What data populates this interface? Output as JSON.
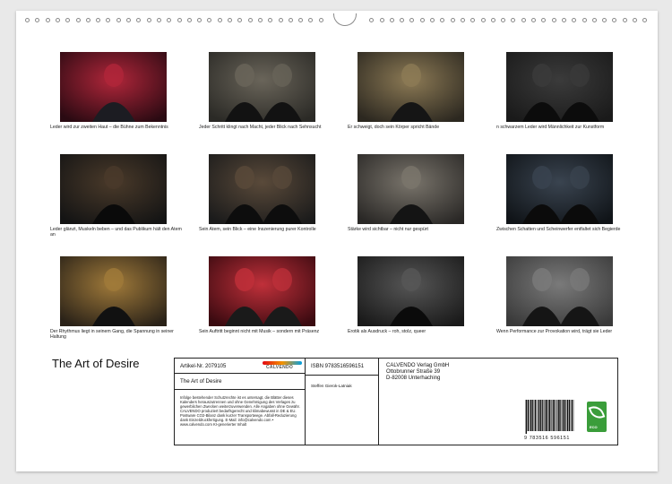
{
  "document": {
    "title": "The Art of Desire"
  },
  "thumbnails": [
    {
      "caption": "Leder wird zur zweiten Haut – die Bühne zum Bekenntnis",
      "icon": "photo-leather-red-light"
    },
    {
      "caption": "Jeder Schritt klingt nach Macht, jeder Blick nach Sehnsucht",
      "icon": "photo-two-men-sunglasses"
    },
    {
      "caption": "Er schweigt, doch sein Körper spricht Bände",
      "icon": "photo-foreheads-touching"
    },
    {
      "caption": "n schwarzem Leder wird Männlichkeit zur Kunstform",
      "icon": "photo-leather-torso"
    },
    {
      "caption": "Leder glänzt, Muskeln beben – und das Publikum hält den Atem an",
      "icon": "photo-blond-gloves"
    },
    {
      "caption": "Sein Atem, sein Blick – eine Inszenierung purer Kontrolle",
      "icon": "photo-two-men-closeup"
    },
    {
      "caption": "Stärke wird sichtbar – nicht nur gespürt",
      "icon": "photo-raised-arms"
    },
    {
      "caption": "Zwischen Schatten und Scheinwerfer entfaltet sich Begierde",
      "icon": "photo-red-hair-men"
    },
    {
      "caption": "Der Rhythmus liegt in seinem Gang, die Spannung in seiner Haltung",
      "icon": "photo-two-men-back"
    },
    {
      "caption": "Sein Auftritt beginnt nicht mit Musik – sondern mit Präsenz",
      "icon": "photo-head-tilted-back"
    },
    {
      "caption": "Erotik als Ausdruck – roh, stolz, queer",
      "icon": "photo-embrace"
    },
    {
      "caption": "Wenn Performance zur Provokation wird, trägt sie Leder",
      "icon": "photo-gloved-hand"
    }
  ],
  "info": {
    "article": "Artikel-Nr. 2079105",
    "logo_text": "CALVENDO",
    "box_title": "The Art of Desire",
    "fine_print": "Infolge bestehender Schutzrechte ist es untersagt, die Blätter dieses Kalenders herauszutrennen und ohne Genehmigung des Verlages zu gewerblichen Zwecken weiterzuverwenden. Alle Angaben ohne Gewähr. CALVENDO produziert bedarfsgerecht und klimabewusst in DE & EU. Postware CO2-Bilanz dank kurzer Transportwege. Abfall-Reduzierung dank Einzeldruckfertigung. E-Mail: info@calvendo.com • www.calvendo.com KI-generierter Inhalt",
    "isbn": "ISBN 9783516596151",
    "author": "Steffen Gierok-Latniak",
    "publisher_line1": "CALVENDO Verlag GmbH",
    "publisher_line2": "Ottobrunner Straße 39",
    "publisher_line3": "D-82008 Unterhaching",
    "barcode_number": "9 783516 596151",
    "eco_label": "ECO"
  }
}
